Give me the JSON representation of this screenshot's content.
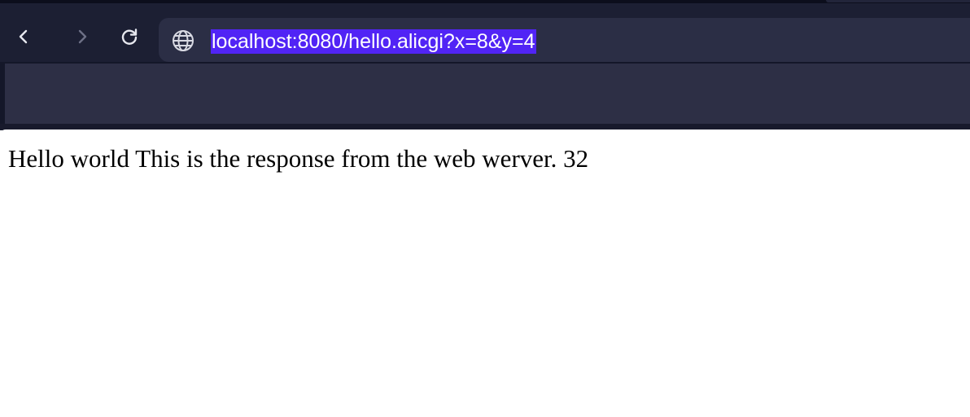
{
  "browser": {
    "nav": {
      "back_icon": "chevron-left-icon",
      "forward_icon": "chevron-right-icon",
      "reload_icon": "reload-icon"
    },
    "address_bar": {
      "site_icon": "globe-icon",
      "url": "localhost:8080/hello.alicgi?x=8&y=4",
      "selected": true,
      "selection_color": "#5124f5"
    },
    "colors": {
      "toolbar": "#1c1f33",
      "omnibox": "#2b2e45",
      "bookmarks_bar": "#2d2f45"
    }
  },
  "page": {
    "body_text": "Hello world This is the response from the web werver. 32",
    "background": "#ffffff"
  }
}
